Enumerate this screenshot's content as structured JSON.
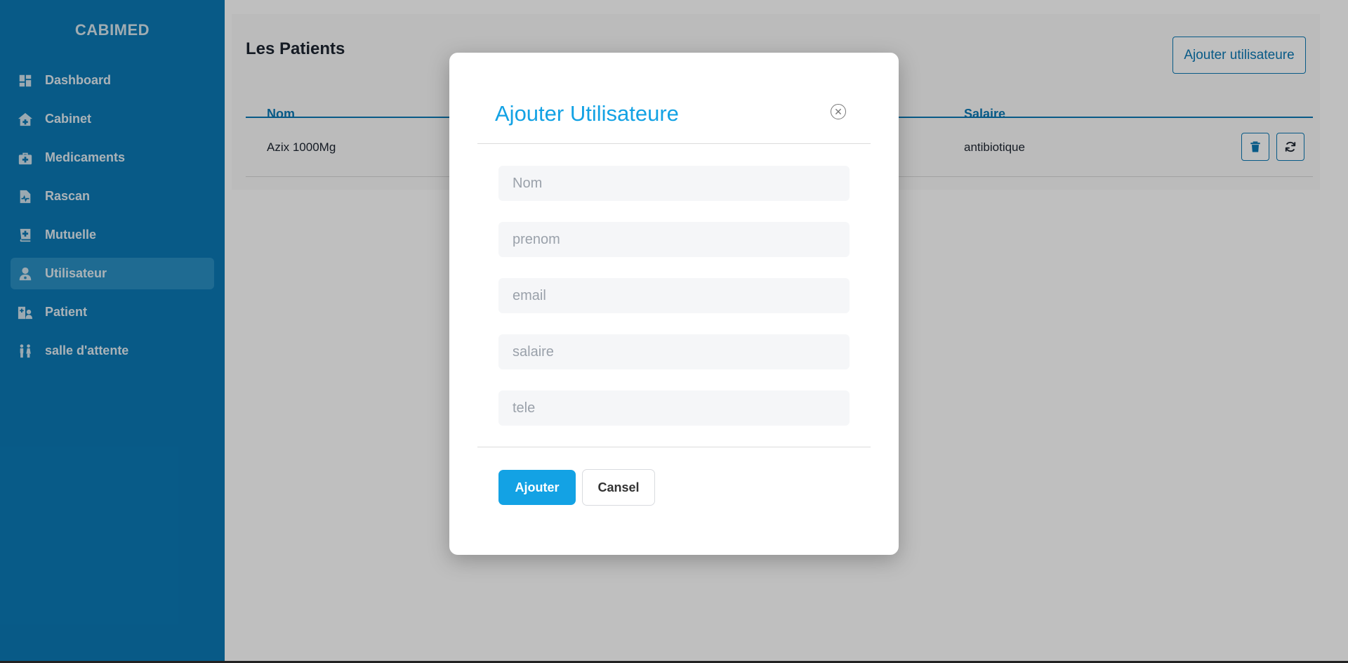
{
  "sidebar": {
    "brand": "CABIMED",
    "items": [
      {
        "label": "Dashboard",
        "icon": "dashboard-icon"
      },
      {
        "label": "Cabinet",
        "icon": "house-medical-icon"
      },
      {
        "label": "Medicaments",
        "icon": "medkit-icon"
      },
      {
        "label": "Rascan",
        "icon": "file-medical-icon"
      },
      {
        "label": "Mutuelle",
        "icon": "book-medical-icon"
      },
      {
        "label": "Utilisateur",
        "icon": "user-doctor-icon",
        "active": true
      },
      {
        "label": "Patient",
        "icon": "hospital-user-icon"
      },
      {
        "label": "salle d'attente",
        "icon": "people-icon"
      }
    ]
  },
  "main": {
    "title": "Les Patients",
    "add_button": "Ajouter utilisateure",
    "table": {
      "headers": {
        "nom": "Nom",
        "salaire": "Salaire"
      },
      "rows": [
        {
          "nom": "Azix 1000Mg",
          "salaire": "antibiotique"
        }
      ]
    }
  },
  "modal": {
    "title": "Ajouter Utilisateure",
    "fields": {
      "nom": "Nom",
      "prenom": "prenom",
      "email": "email",
      "salaire": "salaire",
      "tele": "tele"
    },
    "submit_label": "Ajouter",
    "cancel_label": "Cansel"
  },
  "colors": {
    "sidebar": "#0b79b5",
    "accent": "#13a2e4"
  }
}
